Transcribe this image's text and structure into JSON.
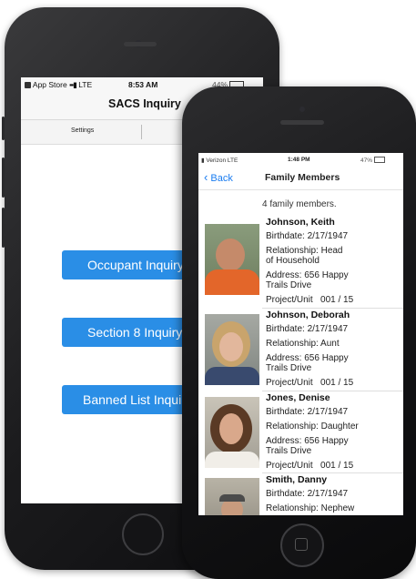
{
  "back_phone": {
    "status": {
      "carrier": "App Store",
      "network": "LTE",
      "time": "8:53 AM",
      "battery": "44%"
    },
    "nav_title": "SACS Inquiry",
    "settings_label": "Settings",
    "buttons": [
      "Occupant Inquiry",
      "Section 8 Inquiry",
      "Banned List Inquiry"
    ]
  },
  "front_phone": {
    "status": {
      "carrier": "Verizon",
      "network": "LTE",
      "time": "1:48 PM",
      "battery": "47%"
    },
    "back_label": "Back",
    "nav_title": "Family Members",
    "count_text": "4 family members.",
    "members": [
      {
        "name": "Johnson, Keith",
        "birthdate": "Birthdate: 2/17/1947",
        "relationship_lines": [
          "Relationship: Head",
          "of Household"
        ],
        "address_lines": [
          "Address: 656 Happy",
          "Trails Drive"
        ],
        "project_unit": "Project/Unit   001 / 15",
        "photo": "man-orange-shirt-photo"
      },
      {
        "name": "Johnson, Deborah",
        "birthdate": "Birthdate: 2/17/1947",
        "relationship_lines": [
          "Relationship: Aunt"
        ],
        "address_lines": [
          "Address: 656 Happy",
          "Trails Drive"
        ],
        "project_unit": "Project/Unit   001 / 15",
        "photo": "woman-blonde-photo"
      },
      {
        "name": "Jones, Denise",
        "birthdate": "Birthdate: 2/17/1947",
        "relationship_lines": [
          "Relationship: Daughter"
        ],
        "address_lines": [
          "Address: 656 Happy",
          "Trails Drive"
        ],
        "project_unit": "Project/Unit   001 / 15",
        "photo": "woman-brunette-photo"
      },
      {
        "name": "Smith, Danny",
        "birthdate": "Birthdate: 2/17/1947",
        "relationship_lines": [
          "Relationship: Nephew"
        ],
        "address_lines": [],
        "project_unit": "",
        "photo": "man-cap-photo"
      }
    ]
  },
  "colors": {
    "accent": "#2a8ee6",
    "ios_blue": "#1a7cf0"
  }
}
